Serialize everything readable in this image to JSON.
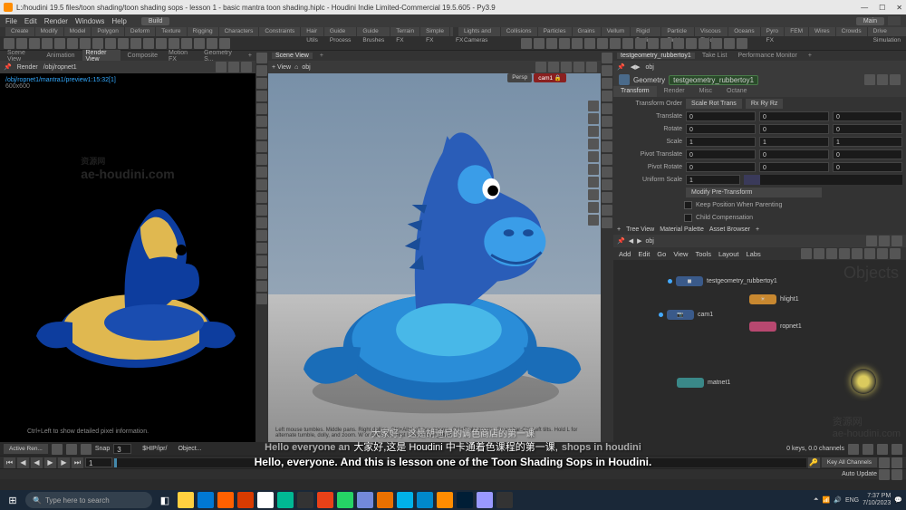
{
  "titlebar": {
    "text": "L:/houdini 19.5 files/toon shading/toon shading sops - lesson 1 - basic mantra toon shading.hiplc - Houdini Indie Limited-Commercial 19.5.605 - Py3.9"
  },
  "menubar": {
    "items": [
      "File",
      "Edit",
      "Render",
      "Windows",
      "Help"
    ],
    "dropdown": "Build",
    "rhs": "Main"
  },
  "shelf_tabs": [
    "Create",
    "Modify",
    "Model",
    "Polygon",
    "Deform",
    "Texture",
    "Rigging",
    "Characters",
    "Constraints",
    "Hair Utils",
    "Guide Process",
    "Guide Brushes",
    "Terrain FX",
    "Simple FX",
    "Cloud FX"
  ],
  "shelf_tabs2": [
    "Lights and Cameras",
    "Collisions",
    "Particles",
    "Grains",
    "Vellum",
    "Rigid Bodies",
    "Particle Fluids",
    "Viscous Fluids",
    "Oceans",
    "Pyro FX",
    "FEM",
    "Wires",
    "Crowds",
    "Drive Simulation"
  ],
  "shelf_row2_items": [
    "Point Light",
    "Spot Light",
    "Area Light",
    "Geometry Light",
    "Distant Light",
    "Environment Light",
    "Sky Light",
    "Portal Light",
    "Caustic Light",
    "GI Light",
    "Ambient",
    "Store Camera",
    "Camera",
    "Switcher",
    "IPR Light",
    "Volume Light",
    "Surface Light",
    "Indirect Light",
    "Fog",
    "Atmosphere"
  ],
  "left": {
    "tabs": [
      "Scene View",
      "Animation",
      "Render View",
      "Composite",
      "Motion FX",
      "Geometry S...",
      "+"
    ],
    "active": "Render View",
    "menu": "Render",
    "path": "/obj/ropnet1",
    "status_path": "/obj/ropnet1/mantra1/preview1:15:32[1]",
    "status_res": "600x600",
    "watermark": "ae-houdini.com",
    "tooltip": "Ctrl+Left to show detailed pixel information."
  },
  "view": {
    "label": "+ View",
    "path_icon": "⌂",
    "path": "obj",
    "persp": "Persp",
    "cam": "cam1 🔒",
    "tip": "Left mouse tumbles. Middle pans. Right dollies. Ctrl+Alt+Left box-zooms. Ctrl+Right zooms. Spacebar-Ctrl-Left tilts. Hold L for alternate tumble, dolly, and zoom.   W or Alt+W for First Person Navigation."
  },
  "params": {
    "tabs_left": [
      "testgeometry_rubbertoy1",
      "Take List",
      "Performance Monitor",
      "+"
    ],
    "path": "obj",
    "type": "Geometry",
    "name": "testgeometry_rubbertoy1",
    "tabs": [
      "Transform",
      "Render",
      "Misc",
      "Octane"
    ],
    "active": "Transform",
    "transform_order": "Scale Rot Trans",
    "rot_order": "Rx Ry Rz",
    "translate": [
      "0",
      "0",
      "0"
    ],
    "rotate": [
      "0",
      "0",
      "0"
    ],
    "scale": [
      "1",
      "1",
      "1"
    ],
    "pivot_translate": [
      "0",
      "0",
      "0"
    ],
    "pivot_rotate": [
      "0",
      "0",
      "0"
    ],
    "uniform_scale": "1",
    "pretransform": "Modify Pre-Transform",
    "keep_pos": "Keep Position When Parenting",
    "child_comp": "Child Compensation"
  },
  "network": {
    "tabs": [
      "+",
      "Tree View",
      "Material Palette",
      "Asset Browser",
      "+"
    ],
    "path": "obj",
    "menu": [
      "Add",
      "Edit",
      "Go",
      "View",
      "Tools",
      "Layout",
      "Labs"
    ],
    "label": "Objects",
    "nodes": {
      "geo": "testgeometry_rubbertoy1",
      "light": "hlight1",
      "cam": "cam1",
      "rop": "ropnet1",
      "mat": "matnet1"
    }
  },
  "timeline": {
    "active_ren": "Active Ren...",
    "snap": "Snap",
    "hip": "$HIP/ipr/",
    "object": "Object...",
    "frame": "1",
    "channels": "0 keys, 0.0 channels",
    "key_all": "Key All Channels"
  },
  "statusbar": {
    "upd": "Auto Update"
  },
  "subtitles": {
    "cn_top": "大家好，这是胡迪尼的调色商店的第一课",
    "en_top": "Hello everyone an",
    "cn": "大家好,这是 Houdini 中卡通着色课程的第一课,",
    "en_mid": "shops in houdini",
    "en": "Hello, everyone. And this is lesson one of the Toon Shading Sops in Houdini."
  },
  "taskbar": {
    "search": "Type here to search",
    "lang": "ENG",
    "time": "7:37 PM",
    "date": "7/10/2023"
  }
}
